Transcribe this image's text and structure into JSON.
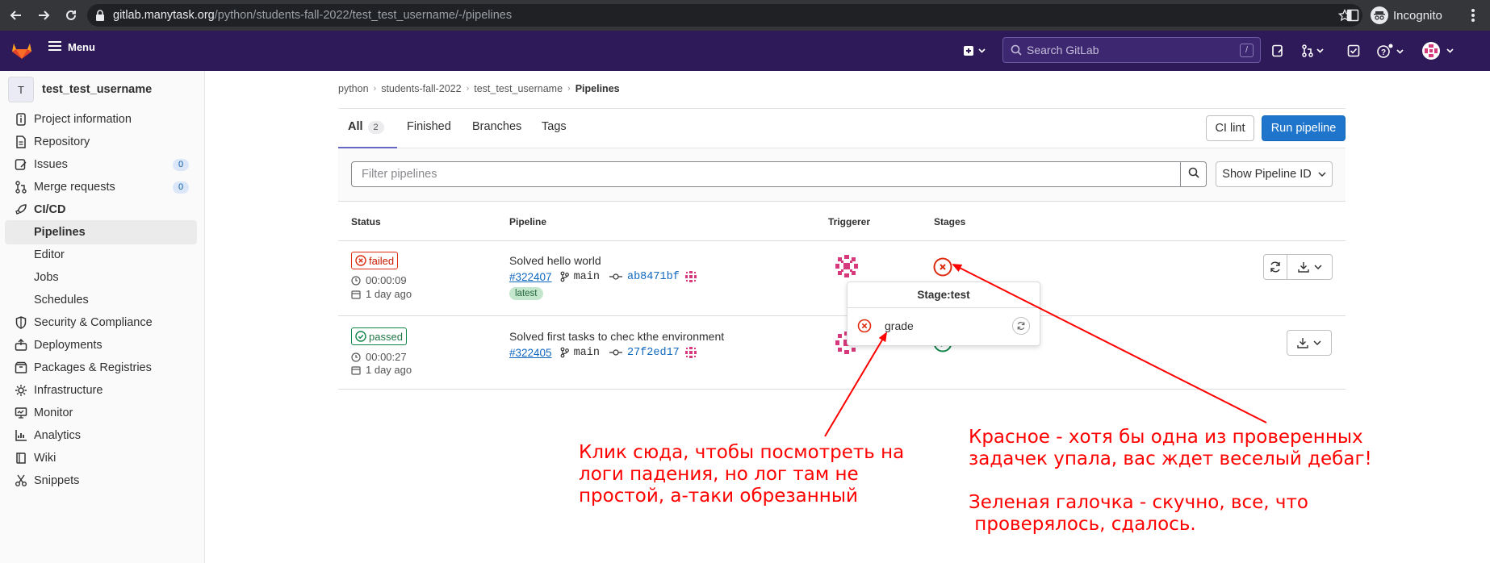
{
  "browser": {
    "url_host": "gitlab.manytask.org",
    "url_path": "/python/students-fall-2022/test_test_username/-/pipelines",
    "incognito_label": "Incognito"
  },
  "topbar": {
    "menu_label": "Menu",
    "search_placeholder": "Search GitLab",
    "search_shortcut": "/"
  },
  "sidebar": {
    "project_initial": "T",
    "project_name": "test_test_username",
    "items": [
      {
        "label": "Project information",
        "icon": "info-icon"
      },
      {
        "label": "Repository",
        "icon": "doc-icon"
      },
      {
        "label": "Issues",
        "icon": "issues-icon",
        "count": "0"
      },
      {
        "label": "Merge requests",
        "icon": "merge-request-icon",
        "count": "0"
      },
      {
        "label": "CI/CD",
        "icon": "rocket-icon"
      },
      {
        "label": "Pipelines"
      },
      {
        "label": "Editor"
      },
      {
        "label": "Jobs"
      },
      {
        "label": "Schedules"
      },
      {
        "label": "Security & Compliance",
        "icon": "shield-icon"
      },
      {
        "label": "Deployments",
        "icon": "deployments-icon"
      },
      {
        "label": "Packages & Registries",
        "icon": "package-icon"
      },
      {
        "label": "Infrastructure",
        "icon": "cloud-gear-icon"
      },
      {
        "label": "Monitor",
        "icon": "monitor-icon"
      },
      {
        "label": "Analytics",
        "icon": "chart-icon"
      },
      {
        "label": "Wiki",
        "icon": "book-icon"
      },
      {
        "label": "Snippets",
        "icon": "snippet-icon"
      }
    ]
  },
  "breadcrumb": [
    "python",
    "students-fall-2022",
    "test_test_username",
    "Pipelines"
  ],
  "tabs": [
    {
      "label": "All",
      "count": "2"
    },
    {
      "label": "Finished"
    },
    {
      "label": "Branches"
    },
    {
      "label": "Tags"
    }
  ],
  "actions": {
    "ci_lint": "CI lint",
    "run_pipeline": "Run pipeline"
  },
  "filter": {
    "placeholder": "Filter pipelines",
    "show_id": "Show Pipeline ID"
  },
  "table": {
    "headers": [
      "Status",
      "Pipeline",
      "Triggerer",
      "Stages"
    ],
    "rows": [
      {
        "status": "failed",
        "duration": "00:00:09",
        "ago": "1 day ago",
        "title": "Solved hello world",
        "pipeline_id": "#322407",
        "branch": "main",
        "commit": "ab8471bf",
        "badge": "latest"
      },
      {
        "status": "passed",
        "duration": "00:00:27",
        "ago": "1 day ago",
        "title": "Solved first tasks to chec kthe environment",
        "pipeline_id": "#322405",
        "branch": "main",
        "commit": "27f2ed17"
      }
    ]
  },
  "stage_dropdown": {
    "header": "Stage:test",
    "job": "grade"
  },
  "annotations": {
    "left": [
      "Клик сюда, чтобы посмотреть на",
      "логи падения, но лог там не",
      "простой, а-таки обрезанный"
    ],
    "right": [
      "Красное - хотя бы одна из проверенных",
      "задачек упала, вас ждет веселый дебаг!",
      "",
      "Зеленая галочка - скучно, все, что",
      " проверялось, сдалось."
    ]
  },
  "colors": {
    "annotation": "#ff0000",
    "gitlab_header": "#2f1a59",
    "primary": "#1f75cb",
    "failed": "#dd2b0e",
    "passed": "#108548"
  }
}
